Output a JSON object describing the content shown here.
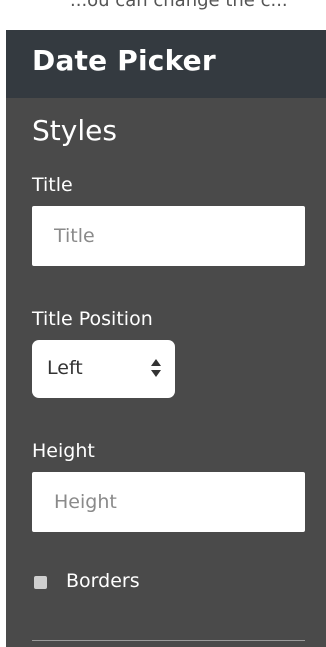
{
  "top_strip_text": "...ou can change the c...",
  "panel": {
    "title": "Date Picker",
    "section_title": "Styles"
  },
  "fields": {
    "title": {
      "label": "Title",
      "placeholder": "Title"
    },
    "title_position": {
      "label": "Title Position",
      "selected": "Left"
    },
    "height": {
      "label": "Height",
      "placeholder": "Height"
    },
    "borders": {
      "label": "Borders",
      "checked": false
    }
  },
  "colors": {
    "panel_bg": "#4a4a4a",
    "header_bg": "#343a40",
    "text": "#ffffff",
    "input_bg": "#ffffff"
  }
}
